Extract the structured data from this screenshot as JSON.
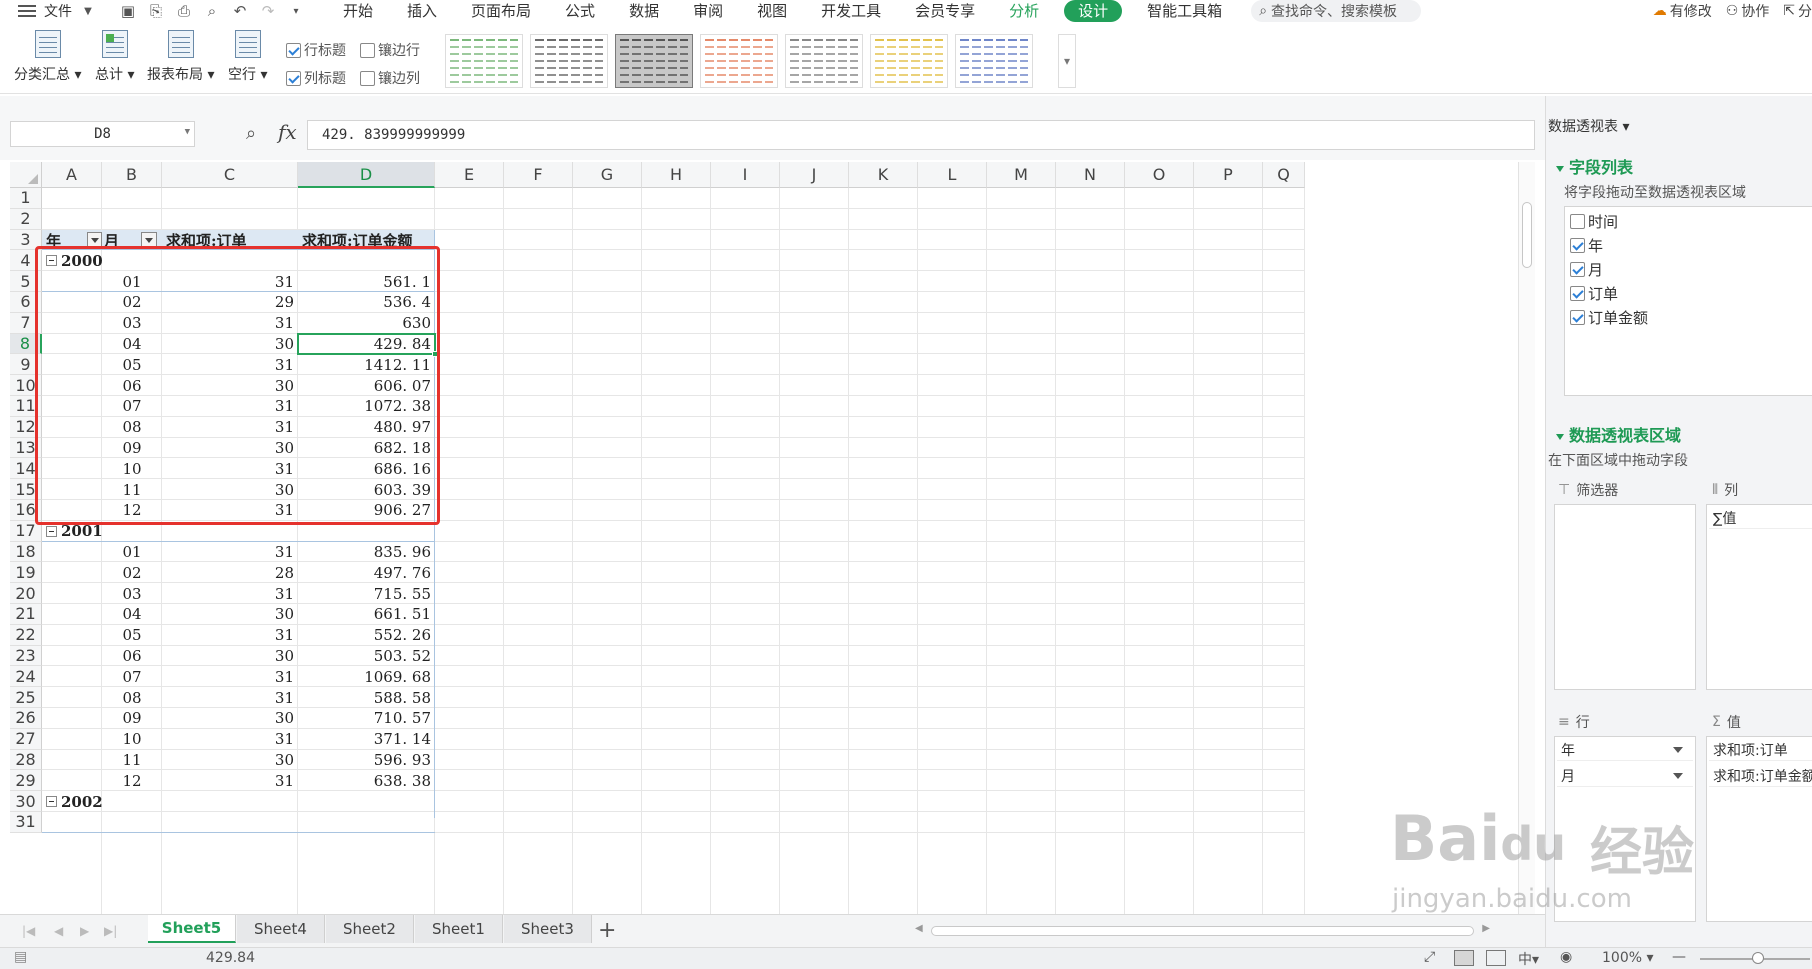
{
  "menubar": {
    "file": "文件",
    "tabs": [
      "开始",
      "插入",
      "页面布局",
      "公式",
      "数据",
      "审阅",
      "视图",
      "开发工具",
      "会员专享",
      "分析",
      "设计",
      "智能工具箱"
    ],
    "search_placeholder": "查找命令、搜索模板",
    "right": {
      "unsaved": "有修改",
      "collab": "协作",
      "share": "分"
    }
  },
  "ribbon": {
    "buttons": [
      "分类汇总",
      "总计",
      "报表布局",
      "空行"
    ],
    "checks": {
      "row_header": "行标题",
      "banded_rows": "镶边行",
      "col_header": "列标题",
      "banded_cols": "镶边列"
    }
  },
  "formula": {
    "cell_ref": "D8",
    "fx": "fx",
    "value": "429. 839999999999"
  },
  "grid": {
    "columns": [
      "A",
      "B",
      "C",
      "D",
      "E",
      "F",
      "G",
      "H",
      "I",
      "J",
      "K",
      "L",
      "M",
      "N",
      "O",
      "P",
      "Q"
    ],
    "rows": [
      "1",
      "2",
      "3",
      "4",
      "5",
      "6",
      "7",
      "8",
      "9",
      "10",
      "11",
      "12",
      "13",
      "14",
      "15",
      "16",
      "17",
      "18",
      "19",
      "20",
      "21",
      "22",
      "23",
      "24",
      "25",
      "26",
      "27",
      "28",
      "29",
      "30",
      "31"
    ],
    "header": {
      "year": "年",
      "month": "月",
      "sum_order": "求和项:订单",
      "sum_amount": "求和项:订单金额"
    },
    "groups": [
      {
        "year": "2000",
        "rows": [
          [
            "01",
            "31",
            "561. 1"
          ],
          [
            "02",
            "29",
            "536. 4"
          ],
          [
            "03",
            "31",
            "630"
          ],
          [
            "04",
            "30",
            "429. 84"
          ],
          [
            "05",
            "31",
            "1412. 11"
          ],
          [
            "06",
            "30",
            "606. 07"
          ],
          [
            "07",
            "31",
            "1072. 38"
          ],
          [
            "08",
            "31",
            "480. 97"
          ],
          [
            "09",
            "30",
            "682. 18"
          ],
          [
            "10",
            "31",
            "686. 16"
          ],
          [
            "11",
            "30",
            "603. 39"
          ],
          [
            "12",
            "31",
            "906. 27"
          ]
        ]
      },
      {
        "year": "2001",
        "rows": [
          [
            "01",
            "31",
            "835. 96"
          ],
          [
            "02",
            "28",
            "497. 76"
          ],
          [
            "03",
            "31",
            "715. 55"
          ],
          [
            "04",
            "30",
            "661. 51"
          ],
          [
            "05",
            "31",
            "552. 26"
          ],
          [
            "06",
            "30",
            "503. 52"
          ],
          [
            "07",
            "31",
            "1069. 68"
          ],
          [
            "08",
            "31",
            "588. 58"
          ],
          [
            "09",
            "30",
            "710. 57"
          ],
          [
            "10",
            "31",
            "371. 14"
          ],
          [
            "11",
            "30",
            "596. 93"
          ],
          [
            "12",
            "31",
            "638. 38"
          ]
        ]
      },
      {
        "year": "2002",
        "rows": []
      }
    ]
  },
  "sheets": [
    "Sheet5",
    "Sheet4",
    "Sheet2",
    "Sheet1",
    "Sheet3"
  ],
  "status": {
    "sum": "429.84",
    "zoom": "100%"
  },
  "panel": {
    "title": "数据透视表",
    "field_section": "字段列表",
    "field_hint": "将字段拖动至数据透视表区域",
    "fields": [
      {
        "name": "时间",
        "checked": false
      },
      {
        "name": "年",
        "checked": true
      },
      {
        "name": "月",
        "checked": true
      },
      {
        "name": "订单",
        "checked": true
      },
      {
        "name": "订单金额",
        "checked": true
      }
    ],
    "area_section": "数据透视表区域",
    "area_hint": "在下面区域中拖动字段",
    "filter_label": "筛选器",
    "col_label": "列",
    "col_item": "∑值",
    "row_label": "行",
    "row_items": [
      "年",
      "月"
    ],
    "val_label": "值",
    "val_items": [
      "求和项:订单",
      "求和项:订单金额"
    ]
  },
  "watermark": {
    "brand": "Bai",
    "brand2": "du",
    "cn": "经验",
    "url": "jingyan.baidu.com"
  }
}
